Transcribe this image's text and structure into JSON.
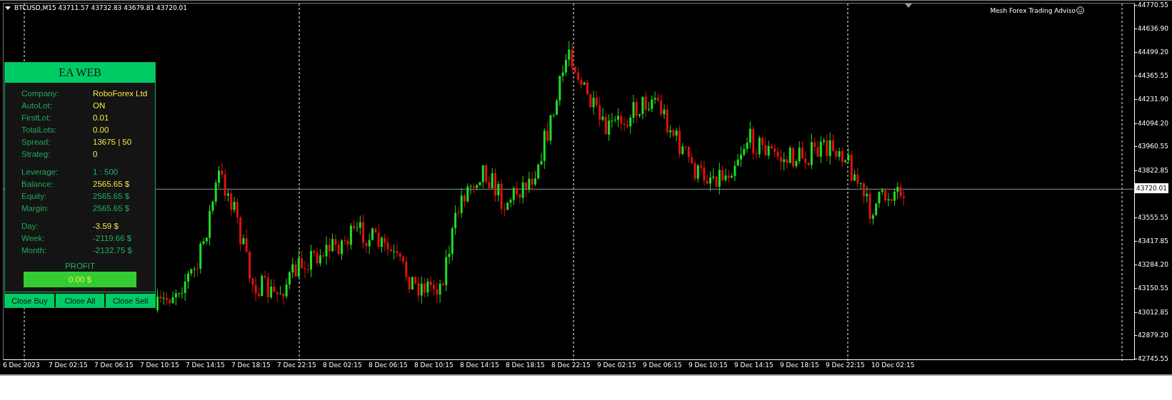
{
  "chart": {
    "header": "BTCUSD,M15  43711.57 43732.83 43679.81 43720.01",
    "expert": "Mesh Forex Trading Adviso",
    "price_axis": [
      "44770.55",
      "44636.90",
      "44499.20",
      "44365.55",
      "44231.90",
      "44094.20",
      "43960.55",
      "43822.85",
      "43555.55",
      "43417.85",
      "43284.20",
      "43150.55",
      "43012.85",
      "42879.20",
      "42745.55"
    ],
    "current_price": "43720.01",
    "time_axis": [
      "6 Dec 2023",
      "7 Dec 02:15",
      "7 Dec 06:15",
      "7 Dec 10:15",
      "7 Dec 14:15",
      "7 Dec 18:15",
      "7 Dec 22:15",
      "8 Dec 02:15",
      "8 Dec 06:15",
      "8 Dec 10:15",
      "8 Dec 14:15",
      "8 Dec 18:15",
      "8 Dec 22:15",
      "9 Dec 02:15",
      "9 Dec 06:15",
      "9 Dec 10:15",
      "9 Dec 14:15",
      "9 Dec 18:15",
      "9 Dec 22:15",
      "10 Dec 02:15"
    ]
  },
  "panel": {
    "title": "EA WEB",
    "sections": [
      [
        {
          "label": "Company:",
          "value": "RoboForex Ltd",
          "kind": "accent"
        },
        {
          "label": "AutoLot:",
          "value": "ON",
          "kind": "accent"
        },
        {
          "label": "FirstLot:",
          "value": "0.01",
          "kind": "accent"
        },
        {
          "label": "TotalLots:",
          "value": "0.00",
          "kind": "accent"
        },
        {
          "label": "Spread:",
          "value": "13675  |  50",
          "kind": "accent"
        },
        {
          "label": "Strateg:",
          "value": "0",
          "kind": "accent"
        }
      ],
      [
        {
          "label": "Leverage:",
          "value": "1 : 500",
          "kind": "plain"
        },
        {
          "label": "Balance:",
          "value": "2565.65 $",
          "kind": "accent"
        },
        {
          "label": "Equity:",
          "value": "2565.65 $",
          "kind": "plain"
        },
        {
          "label": "Margin:",
          "value": "2565.65 $",
          "kind": "plain"
        }
      ],
      [
        {
          "label": "Day:",
          "value": "-3.59 $",
          "kind": "accent"
        },
        {
          "label": "Week:",
          "value": "-2119.66 $",
          "kind": "plain"
        },
        {
          "label": "Month:",
          "value": "-2132.75 $",
          "kind": "plain"
        }
      ]
    ],
    "profit_label": "PROFIT",
    "profit_value": "0.00 $",
    "buttons": [
      "Close Buy",
      "Close All",
      "Close Sell"
    ]
  }
}
